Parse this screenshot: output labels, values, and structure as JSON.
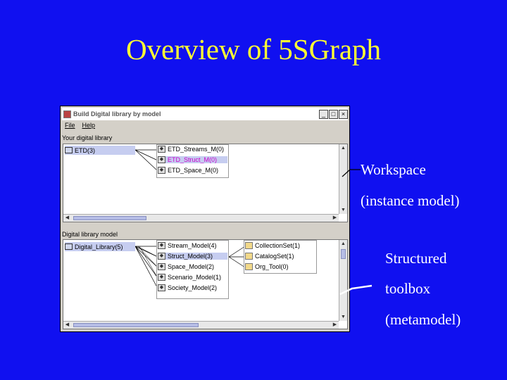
{
  "slide": {
    "title": "Overview of 5SGraph",
    "annotations": {
      "workspace": "Workspace",
      "instance_model": "(instance model)",
      "structured": "Structured",
      "toolbox": "toolbox",
      "metamodel": "(metamodel)"
    }
  },
  "window": {
    "title": "Build Digital library by model",
    "controls": [
      "_",
      "□",
      "×"
    ],
    "menu": [
      "File",
      "Help"
    ]
  },
  "workspace": {
    "label": "Your digital library",
    "root": "ETD(3)",
    "children": [
      "ETD_Streams_M(0)",
      "ETD_Struct_M(0)",
      "ETD_Space_M(0)"
    ]
  },
  "toolbox": {
    "label": "Digital library model",
    "root": "Digital_Library(5)",
    "children": [
      "Stream_Model(4)",
      "Struct_Model(3)",
      "Space_Model(2)",
      "Scenario_Model(1)",
      "Society_Model(2)"
    ],
    "subitems": [
      "CollectionSet(1)",
      "CatalogSet(1)",
      "Org_Tool(0)"
    ]
  },
  "colors": {
    "background": "#1010f0",
    "title": "#ffff33",
    "annotation": "#ffffff",
    "highlight_text": "#cc00cc"
  },
  "icons": {
    "app": "app-icon",
    "computer": "computer-icon",
    "model": "model-icon",
    "collection": "collection-icon"
  }
}
